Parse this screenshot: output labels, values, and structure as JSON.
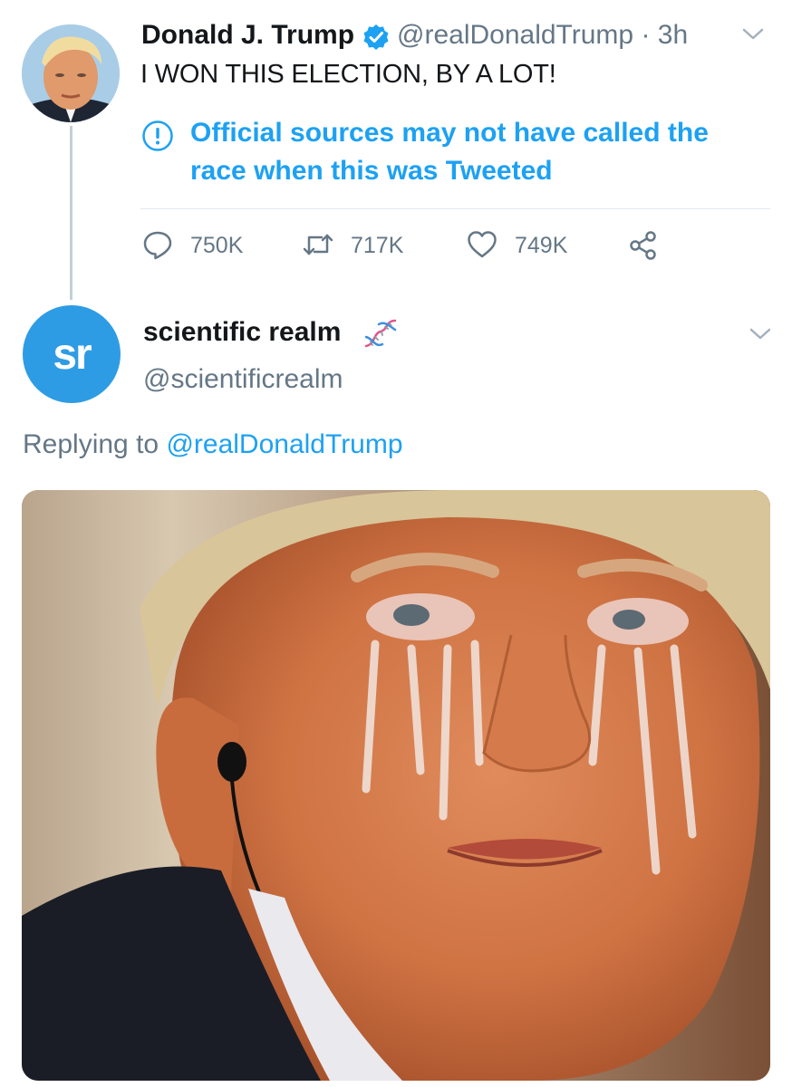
{
  "tweet": {
    "author_name": "Donald J. Trump",
    "handle": "@realDonaldTrump",
    "separator": "·",
    "time": "3h",
    "text": "I WON THIS ELECTION, BY A LOT!",
    "notice": "Official sources may not have called the race when this was Tweeted",
    "actions": {
      "replies": "750K",
      "retweets": "717K",
      "likes": "749K"
    }
  },
  "reply": {
    "author_name": "scientific realm",
    "avatar_text": "sr",
    "handle": "@scientificrealm",
    "replying_prefix": "Replying to",
    "replying_to": "@realDonaldTrump"
  },
  "icons": {
    "verified": "verified-badge-icon",
    "caret": "chevron-down-icon",
    "notice": "exclamation-circle-icon",
    "reply": "reply-icon",
    "retweet": "retweet-icon",
    "like": "heart-icon",
    "share": "share-icon",
    "dna": "dna-emoji-icon"
  },
  "colors": {
    "accent": "#1da1f2",
    "secondary_text": "#657786",
    "avatar_sr": "#2e9ce4",
    "divider": "#e1e8ed"
  }
}
